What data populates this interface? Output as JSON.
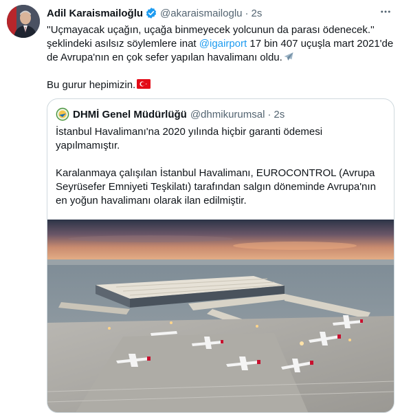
{
  "tweet": {
    "author_name": "Adil Karaismailoğlu",
    "handle": "@akaraismailoglu",
    "separator": "·",
    "time": "2s",
    "text_line1": "''Uçmayacak uçağın, uçağa binmeyecek yolcunun da parası ödenecek.''",
    "text_line2_pre": "şeklindeki asılsız söylemlere inat ",
    "text_link": "@igairport",
    "text_line2_post": " 17 bin 407 uçuşla mart 2021'de",
    "text_line3": "de Avrupa'nın en çok sefer yapılan havalimanı oldu.",
    "text_line4": "Bu gurur hepimizin.",
    "icons": [
      "verified-badge-icon",
      "airplane-emoji",
      "turkey-flag-emoji",
      "more-options-icon"
    ]
  },
  "quote": {
    "author_name": "DHMİ Genel Müdürlüğü",
    "handle": "@dhmikurumsal",
    "separator": "·",
    "time": "2s",
    "para1": "İstanbul Havalimanı'na 2020 yılında hiçbir garanti ödemesi yapılmamıştır.",
    "para2": "Karalanmaya çalışılan İstanbul Havalimanı, EUROCONTROL (Avrupa Seyrüsefer Emniyeti Teşkilatı) tarafından salgın döneminde Avrupa'nın en yoğun havalimanı olarak ilan edilmiştir."
  },
  "colors": {
    "link": "#1d9bf0",
    "muted": "#536471",
    "border": "#cfd9de",
    "verified": "#1d9bf0"
  }
}
